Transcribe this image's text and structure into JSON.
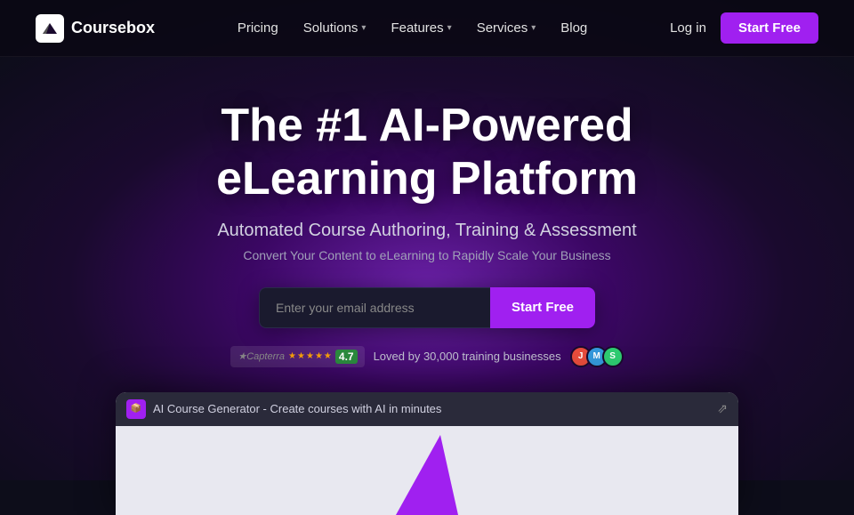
{
  "logo": {
    "text": "Coursebox"
  },
  "nav": {
    "links": [
      {
        "label": "Pricing",
        "hasDropdown": false
      },
      {
        "label": "Solutions",
        "hasDropdown": true
      },
      {
        "label": "Features",
        "hasDropdown": true
      },
      {
        "label": "Services",
        "hasDropdown": true
      },
      {
        "label": "Blog",
        "hasDropdown": false
      }
    ],
    "login_label": "Log in",
    "start_free_label": "Start Free"
  },
  "hero": {
    "title": "The #1 AI-Powered eLearning Platform",
    "subtitle": "Automated Course Authoring, Training & Assessment",
    "sub2": "Convert Your Content to eLearning to Rapidly Scale Your Business",
    "email_placeholder": "Enter your email address",
    "start_free_label": "Start Free"
  },
  "social_proof": {
    "capterra_score": "4.7",
    "text": "Loved by 30,000 training businesses"
  },
  "video": {
    "title": "AI Course Generator - Create courses with AI in minutes",
    "share_icon": "⇗"
  }
}
